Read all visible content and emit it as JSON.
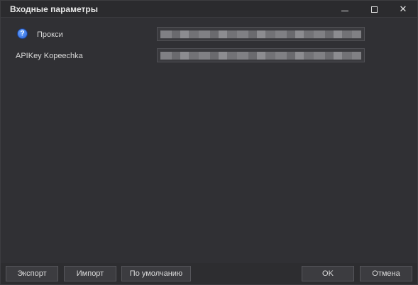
{
  "window": {
    "title": "Входные параметры",
    "minimize_icon": "minimize-icon",
    "maximize_icon": "maximize-icon",
    "close_glyph": "✕"
  },
  "params": [
    {
      "label": "Прокси",
      "icon": "help-icon",
      "icon_glyph": "?",
      "value_masked": true
    },
    {
      "label": "APIKey Kopeechka",
      "value_masked": true
    }
  ],
  "buttons": {
    "export": "Экспорт",
    "import": "Импорт",
    "default": "По умолчанию",
    "ok": "OK",
    "cancel": "Отмена"
  },
  "colors": {
    "background": "#303034",
    "titlebar": "#2b2b2e",
    "field": "#3a3a3e",
    "button": "#3c3c40",
    "text": "#dcdcdc",
    "help_icon": "#2a62d6"
  }
}
